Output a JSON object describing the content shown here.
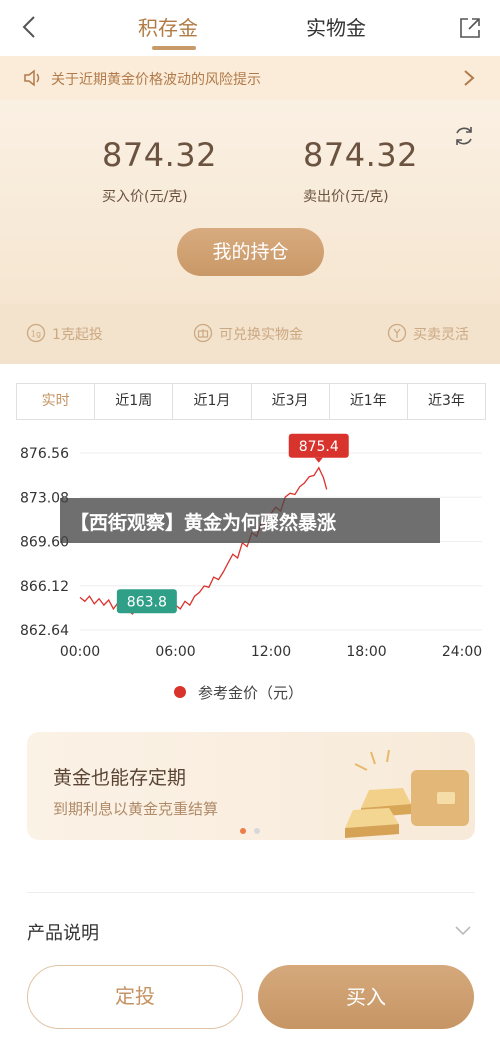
{
  "nav": {
    "tab_active": "积存金",
    "tab_inactive": "实物金"
  },
  "banner": {
    "text": "关于近期黄金价格波动的风险提示"
  },
  "prices": {
    "buy_value": "874.32",
    "buy_label": "买入价(元/克)",
    "sell_value": "874.32",
    "sell_label": "卖出价(元/克)"
  },
  "holding_button": "我的持仓",
  "features": [
    {
      "label": "1克起投",
      "icon": "1g-icon"
    },
    {
      "label": "可兑换实物金",
      "icon": "gift-icon"
    },
    {
      "label": "买卖灵活",
      "icon": "exchange-icon"
    }
  ],
  "ranges": [
    "实时",
    "近1周",
    "近1月",
    "近3月",
    "近1年",
    "近3年"
  ],
  "chart_data": {
    "type": "line",
    "y_ticks": [
      "876.56",
      "873.08",
      "869.60",
      "866.12",
      "862.64"
    ],
    "ylim": [
      862.64,
      876.56
    ],
    "x_ticks": [
      "00:00",
      "06:00",
      "12:00",
      "18:00",
      "24:00"
    ],
    "xlim": [
      0,
      24
    ],
    "series": [
      {
        "name": "参考金价（元）",
        "color": "#d9332e",
        "x": [
          0,
          0.3,
          0.6,
          0.9,
          1.2,
          1.5,
          1.8,
          2.1,
          2.4,
          2.7,
          3.0,
          3.3,
          3.6,
          3.9,
          4.2,
          4.5,
          4.8,
          5.1,
          5.4,
          5.7,
          6.0,
          6.3,
          6.6,
          6.9,
          7.2,
          7.5,
          7.8,
          8.1,
          8.4,
          8.7,
          9.0,
          9.3,
          9.6,
          9.9,
          10.2,
          10.5,
          10.8,
          11.1,
          11.4,
          11.7,
          12.0,
          12.3,
          12.6,
          12.9,
          13.2,
          13.5,
          13.8,
          14.1,
          14.4,
          14.7,
          15.0,
          15.3,
          15.5
        ],
        "values": [
          865.2,
          864.9,
          865.3,
          864.7,
          865.1,
          864.6,
          865.0,
          864.3,
          864.8,
          864.9,
          864.2,
          863.9,
          864.4,
          864.1,
          864.6,
          864.2,
          864.5,
          864.1,
          864.7,
          864.4,
          864.6,
          864.3,
          864.9,
          864.6,
          865.3,
          865.6,
          866.1,
          866.0,
          866.8,
          866.6,
          867.2,
          867.9,
          868.6,
          868.3,
          869.5,
          869.2,
          870.3,
          870.0,
          871.1,
          870.8,
          871.8,
          872.3,
          872.0,
          873.1,
          873.4,
          873.3,
          873.9,
          874.2,
          874.7,
          874.8,
          875.4,
          874.6,
          873.7
        ]
      }
    ],
    "annotations": [
      {
        "text": "875.4",
        "x": 15.0,
        "y": 875.4,
        "color": "#d9332e"
      },
      {
        "text": "863.8",
        "x": 4.2,
        "y": 863.8,
        "color": "#2f9f88"
      }
    ],
    "legend": "参考金价（元）",
    "legend_position": "bottom"
  },
  "caption": "【西街观察】黄金为何骤然暴涨",
  "promo": {
    "title": "黄金也能存定期",
    "subtitle": "到期利息以黄金克重结算"
  },
  "description_label": "产品说明",
  "buttons": {
    "fixed": "定投",
    "buy": "买入"
  },
  "colors": {
    "accent": "#c59262",
    "chart_line": "#d9332e",
    "low_marker": "#2f9f88"
  }
}
